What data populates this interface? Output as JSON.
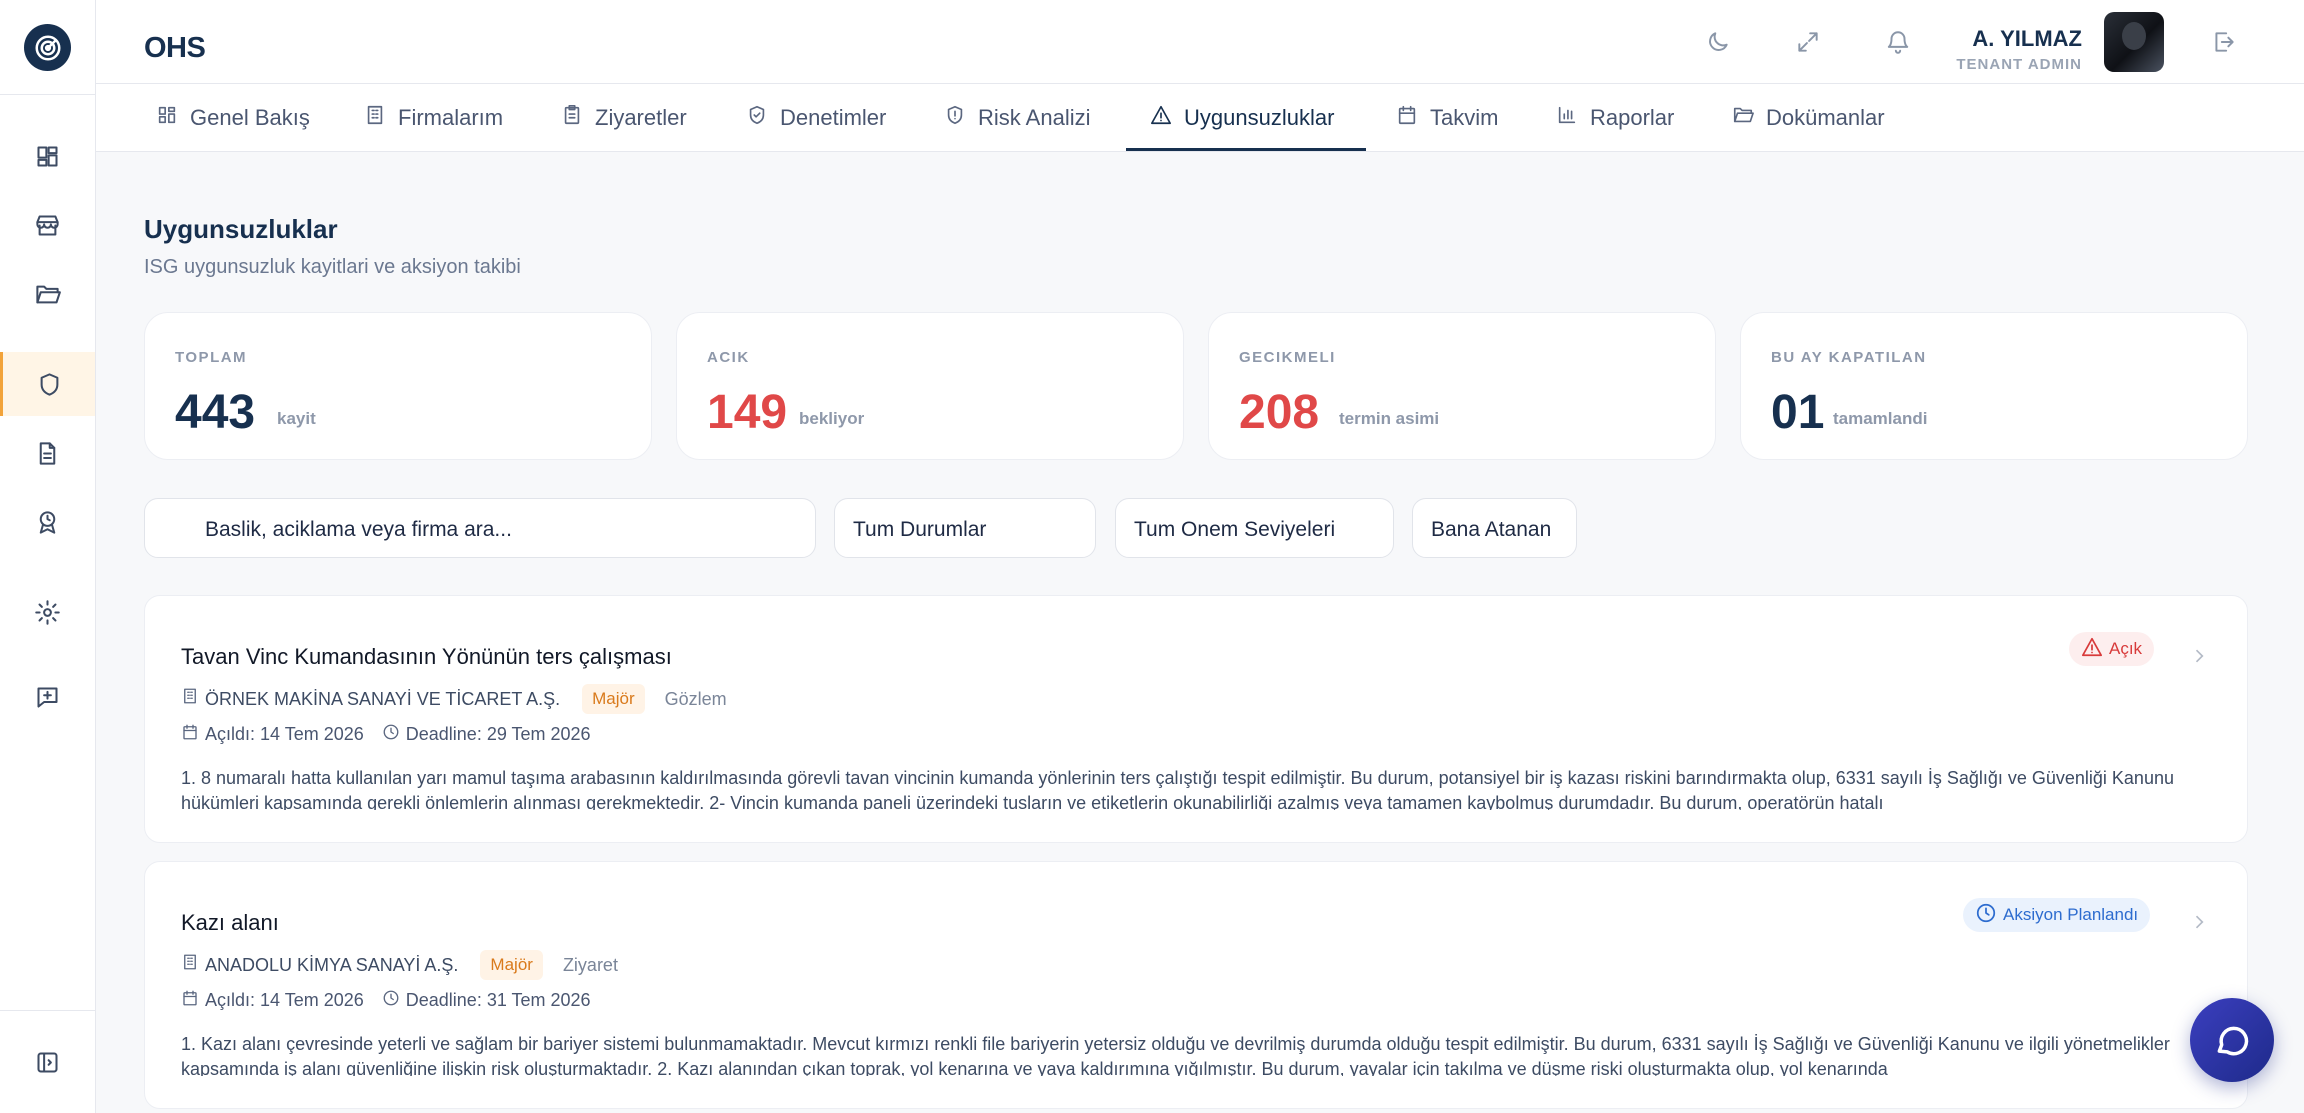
{
  "app": {
    "brand": "OHS"
  },
  "header": {
    "user_name": "A. YILMAZ",
    "user_role": "TENANT ADMIN",
    "icons": [
      "moon-icon",
      "expand-icon",
      "bell-icon",
      "logout-icon"
    ]
  },
  "sidebar": {
    "items": [
      {
        "name": "dashboard-icon"
      },
      {
        "name": "store-icon"
      },
      {
        "name": "folder-icon"
      },
      {
        "name": "shield-icon",
        "active": true
      },
      {
        "name": "document-icon"
      },
      {
        "name": "award-icon"
      },
      {
        "name": "settings-icon"
      },
      {
        "name": "chat-add-icon"
      },
      {
        "name": "sidebar-toggle-icon"
      }
    ]
  },
  "tabs": [
    {
      "label": "Genel Bakış",
      "icon": "grid-icon"
    },
    {
      "label": "Firmalarım",
      "icon": "building-icon"
    },
    {
      "label": "Ziyaretler",
      "icon": "clipboard-icon"
    },
    {
      "label": "Denetimler",
      "icon": "shield-check-icon"
    },
    {
      "label": "Risk Analizi",
      "icon": "shield-alert-icon"
    },
    {
      "label": "Uygunsuzluklar",
      "icon": "warning-icon",
      "active": true
    },
    {
      "label": "Takvim",
      "icon": "calendar-icon"
    },
    {
      "label": "Raporlar",
      "icon": "bar-chart-icon"
    },
    {
      "label": "Dokümanlar",
      "icon": "folder-open-icon"
    }
  ],
  "page": {
    "title": "Uygunsuzluklar",
    "subtitle": "ISG uygunsuzluk kayitlari ve aksiyon takibi"
  },
  "stats": [
    {
      "label": "TOPLAM",
      "value": "443",
      "unit": "kayit"
    },
    {
      "label": "ACIK",
      "value": "149",
      "unit": "bekliyor"
    },
    {
      "label": "GECIKMELI",
      "value": "208",
      "unit": "termin asimi"
    },
    {
      "label": "BU AY KAPATILAN",
      "value": "01",
      "unit": "tamamlandi"
    }
  ],
  "filters": {
    "search_placeholder": "Baslik, aciklama veya firma ara...",
    "status": "Tum Durumlar",
    "severity": "Tum Onem Seviyeleri",
    "assigned": "Bana Atanan"
  },
  "records": [
    {
      "title": "Tavan Vinc Kumandasının Yönünün ters çalışması",
      "company": "ÖRNEK MAKİNA SANAYİ VE TİCARET A.Ş.",
      "severity": "Majör",
      "source": "Gözlem",
      "opened": "Açıldı: 14 Tem 2026",
      "deadline": "Deadline: 29 Tem 2026",
      "status": "Açık",
      "description": "1. 8 numaralı hatta kullanılan yarı mamul taşıma arabasının kaldırılmasında görevli tavan vincinin kumanda yönlerinin ters çalıştığı tespit edilmiştir. Bu durum, potansiyel bir iş kazası riskini barındırmakta olup, 6331 sayılı İş Sağlığı ve Güvenliği Kanunu hükümleri kapsamında gerekli önlemlerin alınması gerekmektedir. 2- Vincin kumanda paneli üzerindeki tusların ve etiketlerin okunabilirliği azalmış veya tamamen kaybolmuş durumdadır. Bu durum, operatörün hatalı"
    },
    {
      "title": "Kazı alanı",
      "company": "ANADOLU KİMYA SANAYİ A.Ş.",
      "severity": "Majör",
      "source": "Ziyaret",
      "opened": "Açıldı: 14 Tem 2026",
      "deadline": "Deadline: 31 Tem 2026",
      "status": "Aksiyon Planlandı",
      "description": "1. Kazı alanı çevresinde yeterli ve sağlam bir bariyer sistemi bulunmamaktadır. Mevcut kırmızı renkli file bariyerin yetersiz olduğu ve devrilmiş durumda olduğu tespit edilmiştir. Bu durum, 6331 sayılı İş Sağlığı ve Güvenliği Kanunu ve ilgili yönetmelikler kapsamında iş alanı güvenliğine ilişkin risk oluşturmaktadır. 2. Kazı alanından çıkan toprak, yol kenarına ve yaya kaldırımına yığılmıştır. Bu durum, yayalar için takılma ve düşme riski oluşturmakta olup, yol kenarında"
    }
  ],
  "colors": {
    "primary": "#17304f",
    "danger": "#e04848",
    "accent": "#f2a33a",
    "info": "#2d6ccf"
  }
}
